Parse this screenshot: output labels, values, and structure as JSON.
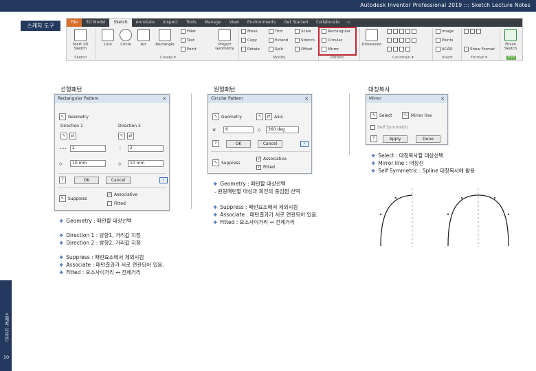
{
  "header": {
    "title": "Autodesk Inventor Professional 2019 ::: Sketch Lecture Notes"
  },
  "section_label": "스케치 도구",
  "ribbon": {
    "tabs": [
      "File",
      "3D Model",
      "Sketch",
      "Annotate",
      "Inspect",
      "Tools",
      "Manage",
      "View",
      "Environments",
      "Get Started",
      "Collaborate"
    ],
    "create": {
      "start_sketch": "Start 2D Sketch",
      "line": "Line",
      "circle": "Circle",
      "arc": "Arc",
      "rectangle": "Rectangle",
      "fillet": "Fillet",
      "text": "Text",
      "point": "Point",
      "project_geometry": "Project Geometry"
    },
    "modify": {
      "move": "Move",
      "trim": "Trim",
      "scale": "Scale",
      "copy": "Copy",
      "extend": "Extend",
      "stretch": "Stretch",
      "rotate": "Rotate",
      "split": "Split",
      "offset": "Offset"
    },
    "pattern": {
      "rectangular": "Rectangular",
      "circular": "Circular",
      "mirror": "Mirror"
    },
    "constrain": {
      "dimension": "Dimension"
    },
    "insert": {
      "image": "Image",
      "points": "Points",
      "acad": "ACAD"
    },
    "format": {
      "show_format": "Show Format"
    },
    "exit": {
      "finish_sketch": "Finish Sketch"
    },
    "panels": {
      "sketch": "Sketch",
      "create": "Create ▾",
      "modify": "Modify",
      "pattern": "Pattern",
      "constrain": "Constrain ▾",
      "insert": "Insert",
      "format": "Format ▾",
      "exit": "Exit"
    }
  },
  "columns": {
    "linear": "선형패턴",
    "circular": "원형패턴",
    "mirror": "대칭복사"
  },
  "rect_dialog": {
    "title": "Rectangular Pattern",
    "geometry": "Geometry",
    "direction1": "Direction 1",
    "direction2": "Direction 2",
    "count1": "2",
    "spacing1": "10 mm",
    "count2": "2",
    "spacing2": "10 mm",
    "ok": "OK",
    "cancel": "Cancel",
    "suppress": "Suppress",
    "associative": "Associative",
    "fitted": "Fitted"
  },
  "circ_dialog": {
    "title": "Circular Pattern",
    "geometry": "Geometry",
    "axis": "Axis",
    "count": "6",
    "angle": "360 deg",
    "ok": "OK",
    "cancel": "Cancel",
    "suppress": "Suppress",
    "associative": "Associative",
    "fitted": "Fitted"
  },
  "mirror_dialog": {
    "title": "Mirror",
    "select": "Select",
    "mirror_line": "Mirror line",
    "self_symmetric": "Self Symmetric",
    "apply": "Apply",
    "done": "Done"
  },
  "notes": {
    "linear": [
      "Geometry : 패턴할 대상선택",
      "Direction 1 : 방향1, 거리값 지정",
      "Direction 2 : 방향2, 거리값 지정",
      "Suppress : 패턴요소에서 제외시킴",
      "Associate : 패턴결과가 서로 연관되어 있음.",
      "Fitted : 요소사이거리 ↔ 전체거리"
    ],
    "circular": [
      "Geometry : 패턴할 대상선택",
      ". 원형패턴할 대상과 회전의 중심점 선택",
      "Suppress : 패턴요소에서 제외시킴",
      "Associate : 패턴결과가 서로 연관되어 있음.",
      "Fitted : 요소사이거리 ↔ 전체거리"
    ],
    "mirror": [
      "Select : 대칭복사할 대상선택",
      "Mirror line : 대칭선",
      "Self Symmetric : Spline 대칭복사에 활용"
    ]
  },
  "sidebar": {
    "text": "스케치 디자인",
    "page_number": "10"
  },
  "colors": {
    "accent": "#23395d",
    "highlight": "#c0272d",
    "bullet": "#2a5aa8"
  }
}
